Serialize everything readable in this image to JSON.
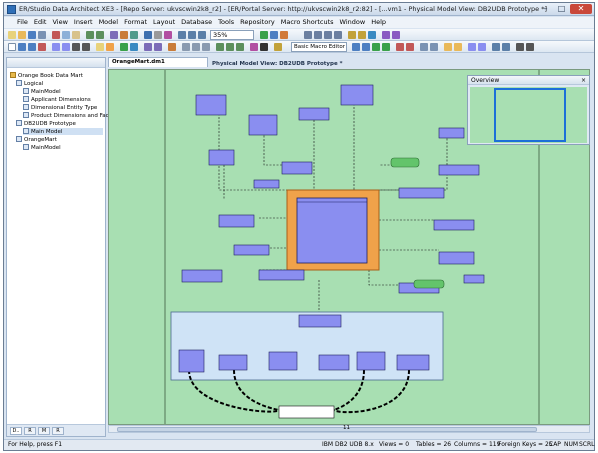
{
  "titlebar": {
    "title": "ER/Studio Data Architect XE3 - [Repo Server: ukvscwin2k8_r2] - [ER/Portal Server: http://ukvscwin2k8_r2:82] - [...vm1 - Physical Model View: DB2UDB Prototype *]",
    "min": "–",
    "max": "□",
    "close": "✕"
  },
  "menu": [
    "File",
    "Edit",
    "View",
    "Insert",
    "Model",
    "Format",
    "Layout",
    "Database",
    "Tools",
    "Repository",
    "Macro Shortcuts",
    "Window",
    "Help"
  ],
  "toolbar": {
    "zoom": "35%",
    "macro": "Basic Macro Editor"
  },
  "explorer": {
    "items": [
      {
        "label": "Orange Book Data Mart"
      },
      {
        "label": "Logical"
      },
      {
        "label": "MainModel"
      },
      {
        "label": "Applicant Dimensions"
      },
      {
        "label": "Dimensional Entity Type"
      },
      {
        "label": "Product Dimensions and Fac"
      },
      {
        "label": "DB2UDB Prototype"
      },
      {
        "label": "Main Model"
      },
      {
        "label": "OrangeMart"
      },
      {
        "label": "MainModel"
      }
    ],
    "bottom_tabs": [
      "D..",
      "R",
      "M",
      "R"
    ]
  },
  "document": {
    "tab": "OrangeMart.dm1",
    "view_title": "Physical Model View: DB2UDB Prototype *",
    "close": "×"
  },
  "overview": {
    "title": "Overview",
    "close": "×"
  },
  "scroll": {
    "value": "11"
  },
  "status": {
    "help": "For Help, press F1",
    "platform": "IBM DB2 UDB 8.x",
    "views": "Views = 0",
    "tables": "Tables = 26",
    "columns": "Columns = 119",
    "foreign_keys": "Foreign Keys = 25",
    "caps": "CAP",
    "num": "NUM",
    "scrl": "SCRL"
  },
  "colors": {
    "canvas": "#a8dfb2",
    "entity": "#8a8ef0",
    "entity_header": "#6b70d9",
    "focus": "#f0a24a",
    "subject_area": "#cfe3f6",
    "title_close": "#c9483a"
  }
}
